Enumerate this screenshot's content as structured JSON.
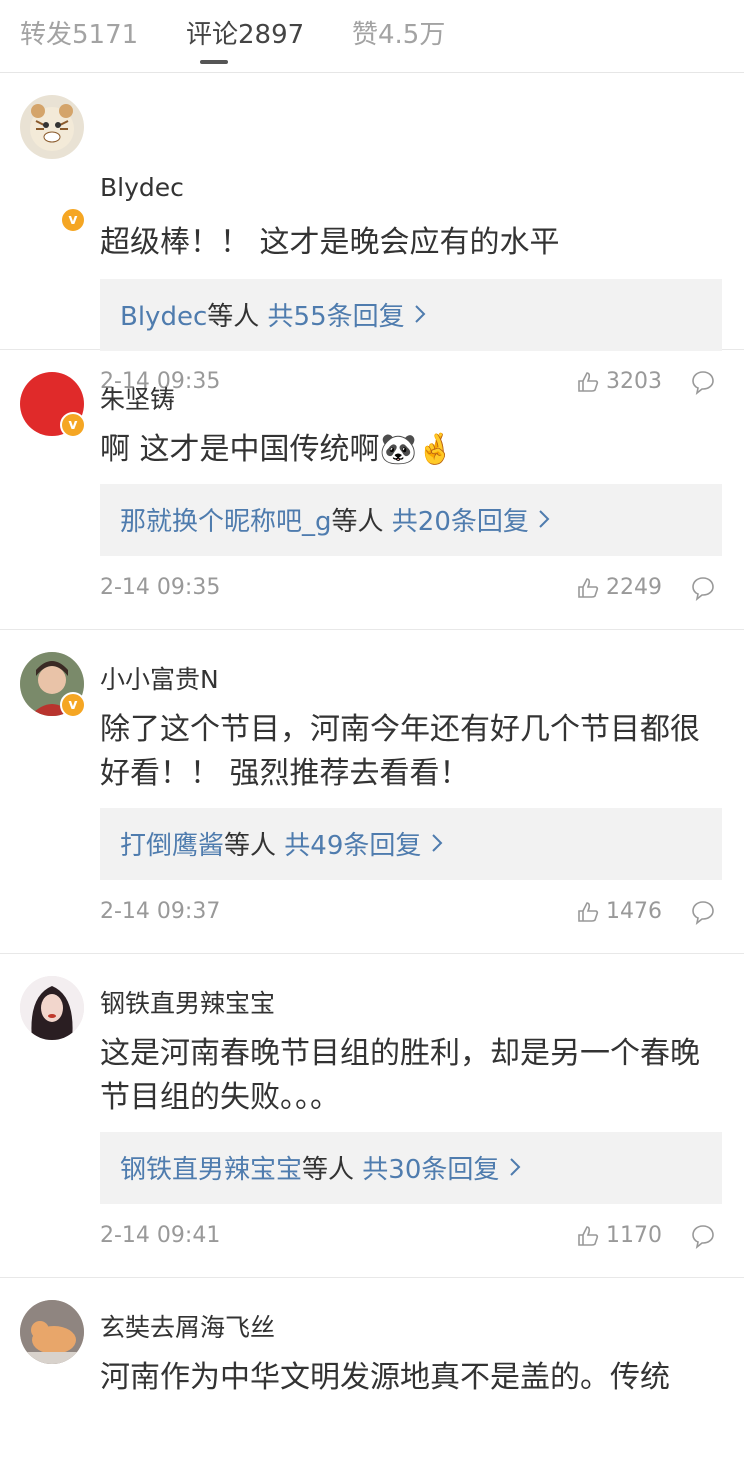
{
  "tabs": [
    {
      "label": "转发5171"
    },
    {
      "label": "评论2897"
    },
    {
      "label": "赞4.5万"
    }
  ],
  "comments": [
    {
      "user": "Blydec",
      "text": "超级棒！！ 这才是晚会应有的水平",
      "reply_user": "Blydec",
      "reply_suffix": "等人",
      "reply_count": "共55条回复",
      "time": "2-14 09:35",
      "likes": "3203"
    },
    {
      "user": "朱坚铸",
      "text": "啊 这才是中国传统啊🐼🤞",
      "reply_user": "那就换个昵称吧_g",
      "reply_suffix": "等人",
      "reply_count": "共20条回复",
      "time": "2-14 09:35",
      "likes": "2249"
    },
    {
      "user": "小小富贵N",
      "text": "除了这个节目，河南今年还有好几个节目都很好看！！ 强烈推荐去看看！",
      "reply_user": "打倒鹰酱",
      "reply_suffix": "等人",
      "reply_count": "共49条回复",
      "time": "2-14 09:37",
      "likes": "1476"
    },
    {
      "user": "钢铁直男辣宝宝",
      "text": "这是河南春晚节目组的胜利，却是另一个春晚节目组的失败。。。",
      "reply_user": "钢铁直男辣宝宝",
      "reply_suffix": "等人",
      "reply_count": "共30条回复",
      "time": "2-14 09:41",
      "likes": "1170"
    },
    {
      "user": "玄奘去屑海飞丝",
      "text": "河南作为中华文明发源地真不是盖的。传统"
    }
  ],
  "colors": {
    "link": "#4f7cae",
    "badge": "#f5a623",
    "avatar2": "#e02a2a"
  }
}
